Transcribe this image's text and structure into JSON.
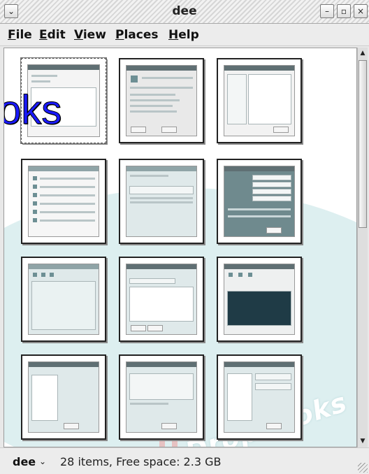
{
  "window": {
    "title": "dee",
    "menu_button_glyph": "⌄",
    "minimize_glyph": "–",
    "maximize_glyph": "▫",
    "close_glyph": "×"
  },
  "menu": {
    "items": [
      "File",
      "Edit",
      "View",
      "Places",
      "Help"
    ]
  },
  "overlay": {
    "text": "oks"
  },
  "watermark": {
    "text": "Dropbooks"
  },
  "content": {
    "thumbnails": [
      {
        "kind": "text-editor",
        "selected": true
      },
      {
        "kind": "run-application"
      },
      {
        "kind": "file-list"
      },
      {
        "kind": "launcher-list"
      },
      {
        "kind": "table-window"
      },
      {
        "kind": "create-user"
      },
      {
        "kind": "table-window"
      },
      {
        "kind": "queue-type"
      },
      {
        "kind": "network-config"
      },
      {
        "kind": "device-type"
      },
      {
        "kind": "select-modem"
      },
      {
        "kind": "select-provider"
      }
    ]
  },
  "scrollbar": {
    "up_glyph": "▲",
    "down_glyph": "▼"
  },
  "status": {
    "location": "dee",
    "chevron": "⌄",
    "text": "28 items, Free space: 2.3 GB"
  },
  "colors": {
    "overlay_text": "#1a1aff",
    "watermark_band": "#cfe8ea",
    "watermark_stripe": "#e9b6b6"
  }
}
